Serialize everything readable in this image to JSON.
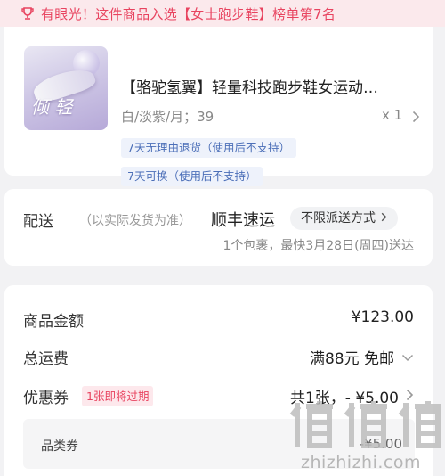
{
  "banner": {
    "icon": "trophy-icon",
    "text": "有眼光！这件商品入选【女士跑步鞋】榜单第7名",
    "color": "#e8435f"
  },
  "product": {
    "image_text": "倾 轻",
    "title": "【骆驼氢翼】轻量科技跑步鞋女运动…",
    "spec": "白/淡紫/月；39",
    "quantity": "x 1",
    "tags": [
      "7天无理由退货（使用后不支持）",
      "7天可换（使用后不支持）"
    ]
  },
  "delivery": {
    "label": "配送",
    "note": "（以实际发货为准）",
    "carrier": "顺丰速运",
    "method_button": "不限派送方式",
    "info": "1个包裹，最快3月28日(周四)送达"
  },
  "price": {
    "goods_label": "商品金额",
    "goods_value": "¥123.00",
    "shipping_label": "总运费",
    "shipping_value": "满88元 免邮",
    "coupon_label": "优惠券",
    "coupon_badge": "1张即将过期",
    "coupon_value": "共1张，- ¥5.00",
    "sub_label": "品类券",
    "sub_value": "-¥5.00"
  },
  "watermark": {
    "text": "值值值",
    "url": "zhizhizhi.com"
  }
}
